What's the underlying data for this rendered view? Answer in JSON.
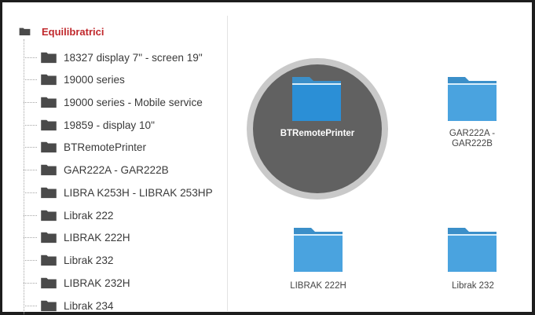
{
  "tree": {
    "root_label": "Equilibratrici",
    "items": [
      {
        "label": "18327 display 7\" - screen 19\""
      },
      {
        "label": "19000 series"
      },
      {
        "label": "19000 series - Mobile service"
      },
      {
        "label": "19859 - display 10\""
      },
      {
        "label": "BTRemotePrinter"
      },
      {
        "label": "GAR222A - GAR222B"
      },
      {
        "label": "LIBRA K253H - LIBRAK 253HP"
      },
      {
        "label": "Librak 222"
      },
      {
        "label": "LIBRAK 222H"
      },
      {
        "label": "Librak 232"
      },
      {
        "label": "LIBRAK 232H"
      },
      {
        "label": "Librak 234"
      }
    ]
  },
  "grid": {
    "tiles": [
      {
        "label": "BTRemotePrinter",
        "selected": true
      },
      {
        "label": "GAR222A -\nGAR222B",
        "selected": false
      },
      {
        "label": "LIBRAK 222H",
        "selected": false
      },
      {
        "label": "Librak 232",
        "selected": false
      }
    ]
  },
  "colors": {
    "root_label": "#c0282c",
    "tree_folder": "#4a4a4a",
    "folder_blue": "#4aa3df",
    "folder_blue_selected": "#2b8fd6",
    "folder_tab": "#3b8fc9",
    "selection_circle": "#616161",
    "selection_ring": "#c9c9c9"
  },
  "icons": {
    "tree_folder": "folder-icon",
    "tile_folder": "folder-icon"
  }
}
